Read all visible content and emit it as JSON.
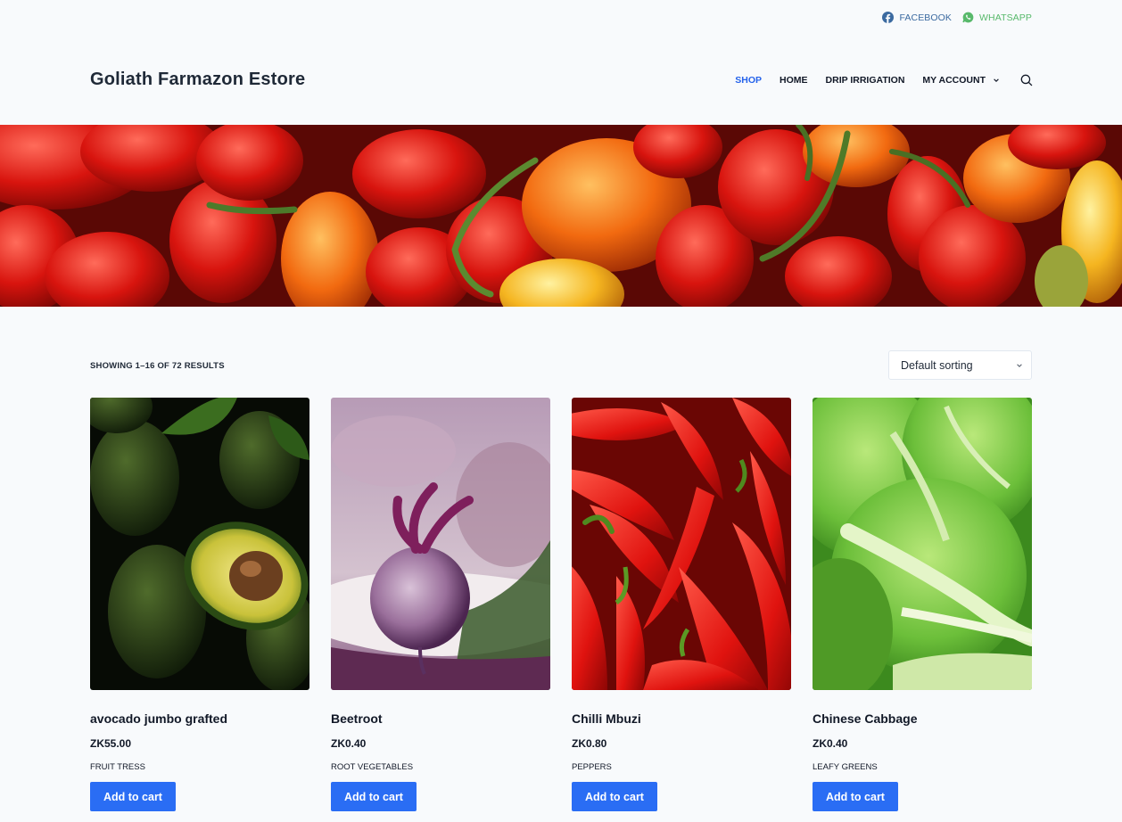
{
  "topbar": {
    "facebook_label": "FACEBOOK",
    "whatsapp_label": "WHATSAPP"
  },
  "header": {
    "site_title": "Goliath Farmazon Estore",
    "nav": [
      {
        "label": "SHOP",
        "active": true
      },
      {
        "label": "HOME"
      },
      {
        "label": "DRIP IRRIGATION"
      },
      {
        "label": "MY ACCOUNT",
        "has_dropdown": true
      }
    ]
  },
  "shop": {
    "result_count": "SHOWING 1–16 OF 72 RESULTS",
    "sorting_selected": "Default sorting"
  },
  "products": [
    {
      "name": "avocado jumbo grafted",
      "price": "ZK55.00",
      "category": "FRUIT TRESS",
      "button": "Add to cart"
    },
    {
      "name": "Beetroot",
      "price": "ZK0.40",
      "category": "ROOT VEGETABLES",
      "button": "Add to cart"
    },
    {
      "name": "Chilli Mbuzi",
      "price": "ZK0.80",
      "category": "PEPPERS",
      "button": "Add to cart"
    },
    {
      "name": "Chinese Cabbage",
      "price": "ZK0.40",
      "category": "LEAFY GREENS",
      "button": "Add to cart"
    }
  ],
  "colors": {
    "accent": "#2a6df4",
    "active_nav": "#2563eb",
    "facebook": "#3b6aa0",
    "whatsapp": "#58b96b"
  }
}
